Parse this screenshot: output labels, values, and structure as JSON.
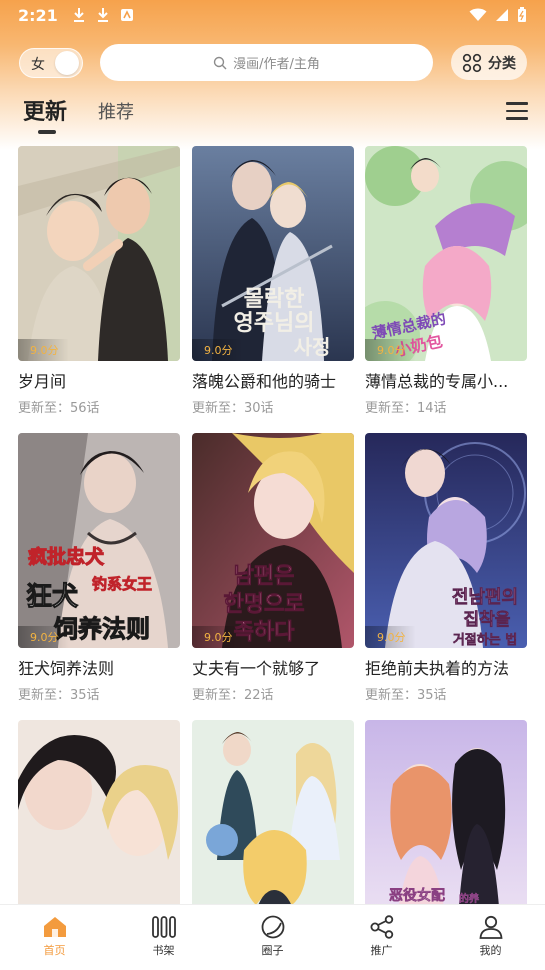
{
  "status_bar": {
    "time": "2:21"
  },
  "header": {
    "gender_label": "女",
    "search_placeholder": "漫画/作者/主角",
    "category_label": "分类"
  },
  "tabs": [
    {
      "label": "更新",
      "active": true
    },
    {
      "label": "推荐",
      "active": false
    }
  ],
  "comics": [
    {
      "title": "岁月间",
      "rating": "9.0分",
      "update": "更新至：56话"
    },
    {
      "title": "落魄公爵和他的骑士",
      "rating": "9.0分",
      "update": "更新至：30话"
    },
    {
      "title": "薄情总裁的专属小...",
      "rating": "9.0分",
      "update": "更新至：14话"
    },
    {
      "title": "狂犬饲养法则",
      "rating": "9.0分",
      "update": "更新至：35话"
    },
    {
      "title": "丈夫有一个就够了",
      "rating": "9.0分",
      "update": "更新至：22话"
    },
    {
      "title": "拒绝前夫执着的方法",
      "rating": "9.0分",
      "update": "更新至：35话"
    },
    {
      "title": "",
      "rating": "",
      "update": ""
    },
    {
      "title": "",
      "rating": "",
      "update": ""
    },
    {
      "title": "",
      "rating": "",
      "update": ""
    }
  ],
  "cover_text": {
    "c2": [
      "몰락한",
      "영주님의",
      "사정"
    ],
    "c3": [
      "薄情总裁的",
      "小奶包"
    ],
    "c4": [
      "疯批忠犬",
      "狂犬",
      "钓系女王",
      "饲养法则"
    ],
    "c5": [
      "남편은",
      "한명으로",
      "족하다"
    ],
    "c6": [
      "전남편의",
      "집착을",
      "거절하는 법"
    ],
    "c9": [
      "恶役女配",
      "的养",
      "成"
    ]
  },
  "bottom_nav": [
    {
      "label": "首页",
      "icon": "home-icon",
      "active": true
    },
    {
      "label": "书架",
      "icon": "bookshelf-icon",
      "active": false
    },
    {
      "label": "圈子",
      "icon": "circle-icon",
      "active": false
    },
    {
      "label": "推广",
      "icon": "share-icon",
      "active": false
    },
    {
      "label": "我的",
      "icon": "profile-icon",
      "active": false
    }
  ],
  "colors": {
    "accent": "#f39b3e",
    "rating": "#f2b342",
    "header_top": "#f6a24c"
  }
}
